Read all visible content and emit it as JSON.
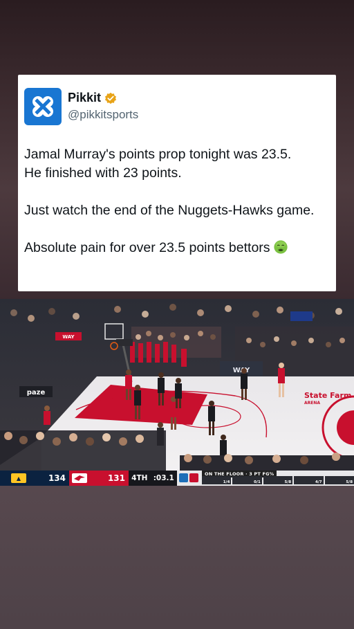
{
  "tweet": {
    "display_name": "Pikkit",
    "handle": "@pikkitsports",
    "verified": true,
    "avatar_icon": "pikkit-logo-icon",
    "avatar_color": "#1976d2",
    "paragraphs": [
      "Jamal Murray's points prop tonight was 23.5.\nHe finished with 23 points.",
      "Just watch the end of the Nuggets-Hawks game.",
      "Absolute pain for over 23.5 points bettors"
    ],
    "emoji": "nauseated-face-icon"
  },
  "video": {
    "scoreboard": {
      "away_team": "DEN",
      "away_score": "134",
      "home_team": "ATL",
      "home_score": "131",
      "quarter": "4TH",
      "clock": ":03.1",
      "on_floor_label": "ON THE FLOOR · 3 PT FG%",
      "players": [
        "1/4",
        "0/1",
        "5/8",
        "4/7",
        "5/8"
      ]
    },
    "court_signs": [
      "WAY",
      "paze",
      "State Farm ARENA"
    ]
  }
}
